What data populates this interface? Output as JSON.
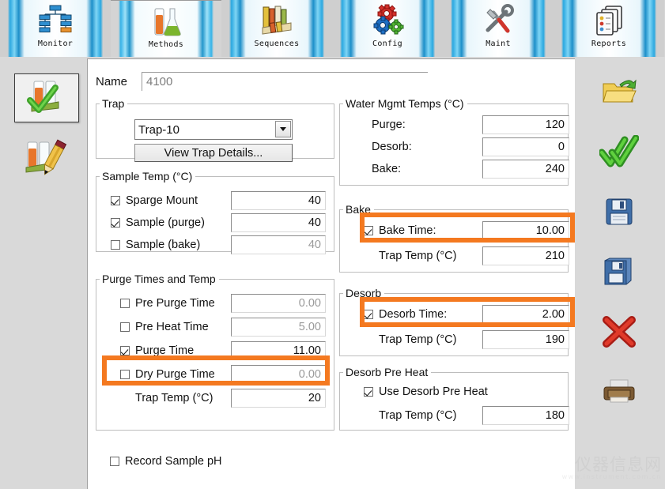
{
  "toolbar": {
    "buttons": [
      {
        "label": "Monitor",
        "icon": "monitor-icon",
        "active": false
      },
      {
        "label": "Methods",
        "icon": "flask-icon",
        "active": true
      },
      {
        "label": "Sequences",
        "icon": "books-icon",
        "active": false
      },
      {
        "label": "Config",
        "icon": "gears-icon",
        "active": false
      },
      {
        "label": "Maint",
        "icon": "tools-icon",
        "active": false
      },
      {
        "label": "Reports",
        "icon": "documents-icon",
        "active": false
      }
    ]
  },
  "left_rail": {
    "items": [
      {
        "icon": "tubes-check-icon",
        "selected": true
      },
      {
        "icon": "tubes-pencil-icon",
        "selected": false
      }
    ]
  },
  "right_rail": {
    "items": [
      {
        "icon": "open-folder-icon"
      },
      {
        "icon": "double-check-icon"
      },
      {
        "icon": "save-icon"
      },
      {
        "icon": "save-as-icon"
      },
      {
        "icon": "delete-x-icon"
      },
      {
        "icon": "print-icon"
      }
    ]
  },
  "form": {
    "name": {
      "label": "Name",
      "value": "4100",
      "placeholder": ""
    },
    "trap": {
      "legend": "Trap",
      "selected": "Trap-10",
      "options": [
        "Trap-10"
      ],
      "details_button": "View Trap Details..."
    },
    "sample_temp": {
      "legend": "Sample Temp (°C)",
      "rows": [
        {
          "label": "Sparge Mount",
          "checked": true,
          "value": "40",
          "enabled": true
        },
        {
          "label": "Sample (purge)",
          "checked": true,
          "value": "40",
          "enabled": true
        },
        {
          "label": "Sample (bake)",
          "checked": false,
          "value": "40",
          "enabled": false
        }
      ]
    },
    "purge_times": {
      "legend": "Purge Times and Temp",
      "rows": [
        {
          "label": "Pre Purge Time",
          "checked": false,
          "value": "0.00",
          "enabled": false,
          "highlighted": false
        },
        {
          "label": "Pre Heat Time",
          "checked": false,
          "value": "5.00",
          "enabled": false,
          "highlighted": false
        },
        {
          "label": "Purge Time",
          "checked": true,
          "value": "11.00",
          "enabled": true,
          "highlighted": true
        },
        {
          "label": "Dry Purge Time",
          "checked": false,
          "value": "0.00",
          "enabled": false,
          "highlighted": false
        }
      ],
      "trap_temp": {
        "label": "Trap Temp (°C)",
        "value": "20"
      }
    },
    "water_mgmt": {
      "legend": "Water Mgmt Temps (°C)",
      "rows": [
        {
          "label": "Purge:",
          "value": "120"
        },
        {
          "label": "Desorb:",
          "value": "0"
        },
        {
          "label": "Bake:",
          "value": "240"
        }
      ]
    },
    "bake": {
      "legend": "Bake",
      "bake_time": {
        "label": "Bake Time:",
        "checked": true,
        "value": "10.00",
        "highlighted": true
      },
      "trap_temp": {
        "label": "Trap Temp (°C)",
        "value": "210"
      }
    },
    "desorb": {
      "legend": "Desorb",
      "desorb_time": {
        "label": "Desorb Time:",
        "checked": true,
        "value": "2.00",
        "highlighted": true
      },
      "trap_temp": {
        "label": "Trap Temp (°C)",
        "value": "190"
      }
    },
    "desorb_preheat": {
      "legend": "Desorb Pre Heat",
      "use": {
        "label": "Use Desorb Pre Heat",
        "checked": true
      },
      "trap_temp": {
        "label": "Trap Temp (°C)",
        "value": "180"
      }
    },
    "record_ph": {
      "label": "Record Sample pH",
      "checked": false
    }
  },
  "watermark": {
    "top": "仪器信息网",
    "bottom": "www.instrument.com.cn"
  },
  "colors": {
    "highlight": "#f47920",
    "panel_bg": "#ffffff",
    "app_bg": "#d9d9d9"
  }
}
